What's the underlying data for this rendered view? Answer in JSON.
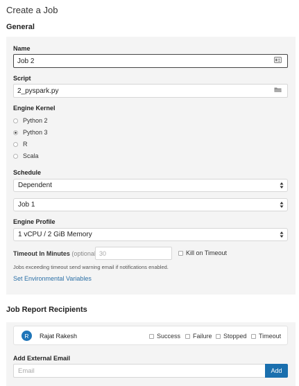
{
  "page_title": "Create a Job",
  "general": {
    "section_title": "General",
    "name": {
      "label": "Name",
      "value": "Job 2",
      "icon": "id-card-icon"
    },
    "script": {
      "label": "Script",
      "value": "2_pyspark.py",
      "icon": "folder-icon"
    },
    "engine_kernel": {
      "label": "Engine Kernel",
      "options": [
        "Python 2",
        "Python 3",
        "R",
        "Scala"
      ],
      "selected": "Python 3"
    },
    "schedule": {
      "label": "Schedule",
      "value": "Dependent",
      "dependency_value": "Job 1"
    },
    "engine_profile": {
      "label": "Engine Profile",
      "value": "1 vCPU / 2 GiB Memory"
    },
    "timeout": {
      "label": "Timeout In Minutes",
      "optional": "(optional)",
      "placeholder": "30",
      "kill_label": "Kill on Timeout",
      "kill_checked": false
    },
    "hint": "Jobs exceeding timeout send warning email if notifications enabled.",
    "env_link": "Set Environmental Variables"
  },
  "report": {
    "section_title": "Job Report Recipients",
    "recipient": {
      "initial": "R",
      "name": "Rajat Rakesh",
      "options": [
        "Success",
        "Failure",
        "Stopped",
        "Timeout"
      ]
    },
    "external_email": {
      "label": "Add External Email",
      "placeholder": "Email",
      "button": "Add"
    }
  },
  "colors": {
    "panel": "#f4f4f4",
    "link": "#2a6fa6",
    "accent": "#1a6fae",
    "avatar": "#1f75b8"
  }
}
